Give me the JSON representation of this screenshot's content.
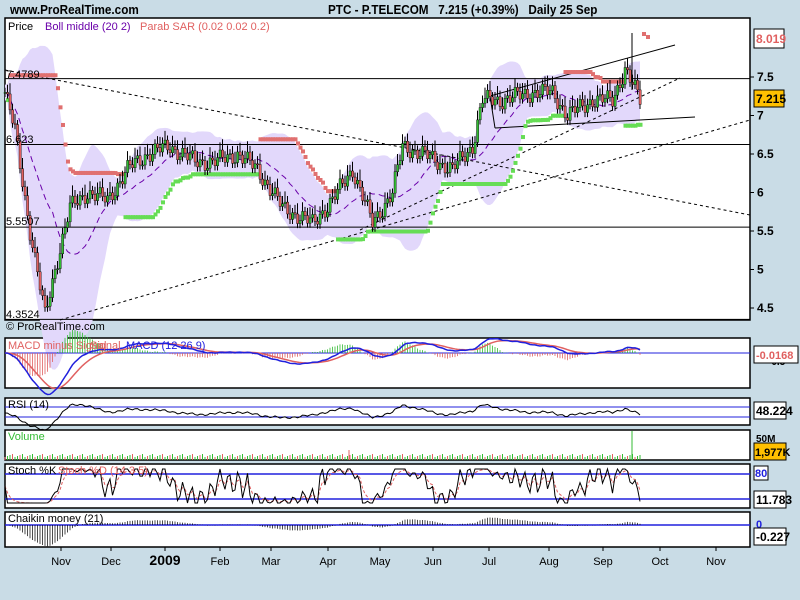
{
  "header": {
    "site": "www.ProRealTime.com",
    "title": "PTC - P.TELECOM",
    "quote": "7.215 (+0.39%)",
    "period": "Daily",
    "date": "25 Sep"
  },
  "panels": {
    "price": {
      "labels": [
        "Price",
        "Boll middle (20 2)",
        "Parab SAR (0.02 0.02 0.2)"
      ],
      "last": "7.215",
      "sar_last": "8.019",
      "watermark": "© ProRealTime.com",
      "levels": [
        "7.4789",
        "6.623",
        "5.5507",
        "4.3524"
      ]
    },
    "macd": {
      "labels": [
        "MACD minus Signal",
        "Signal",
        "MACD (12 26 9)"
      ],
      "last": "-0.0168",
      "tick": "-0.5"
    },
    "rsi": {
      "label": "RSI (14)",
      "last": "48.224"
    },
    "volume": {
      "label": "Volume",
      "tick": "50M",
      "last": "1,977K"
    },
    "stoch": {
      "labels": [
        "Stoch %K",
        "Stoch %D (14 3 5)"
      ],
      "level": "80",
      "last": "11.783"
    },
    "chaikin": {
      "label": "Chaikin money (21)",
      "zero": "0",
      "last": "-0.227"
    }
  },
  "colors": {
    "up": "#33bb33",
    "down": "#e06060",
    "sar_up": "#66dd55",
    "sar_down": "#e07070",
    "boll": "#6a00aa",
    "band": "#e2d8fb",
    "ref": "#2020dd",
    "last_bg": "#ffc000"
  },
  "chart_data": {
    "type": "candlestick",
    "x_ticks": [
      "Nov",
      "Dec",
      "2009",
      "Feb",
      "Mar",
      "Apr",
      "May",
      "Jun",
      "Jul",
      "Aug",
      "Sep",
      "Oct",
      "Nov"
    ],
    "y_ticks": [
      "7.5",
      "7",
      "6.5",
      "6",
      "5.5",
      "5",
      "4.5"
    ],
    "ylim": [
      4.3,
      7.9
    ],
    "close_keypoints": [
      [
        0,
        7.3
      ],
      [
        4,
        6.8
      ],
      [
        10,
        5.5
      ],
      [
        16,
        4.4
      ],
      [
        20,
        5.0
      ],
      [
        26,
        5.8
      ],
      [
        33,
        6.0
      ],
      [
        41,
        5.9
      ],
      [
        49,
        6.3
      ],
      [
        57,
        6.5
      ],
      [
        66,
        6.6
      ],
      [
        76,
        6.4
      ],
      [
        84,
        6.4
      ],
      [
        93,
        6.5
      ],
      [
        101,
        6.3
      ],
      [
        111,
        5.8
      ],
      [
        123,
        5.6
      ],
      [
        131,
        5.9
      ],
      [
        139,
        6.3
      ],
      [
        147,
        5.6
      ],
      [
        155,
        6.0
      ],
      [
        159,
        6.6
      ],
      [
        167,
        6.5
      ],
      [
        179,
        6.3
      ],
      [
        187,
        6.6
      ],
      [
        191,
        7.2
      ],
      [
        199,
        7.2
      ],
      [
        211,
        7.3
      ],
      [
        219,
        7.3
      ],
      [
        225,
        7.0
      ],
      [
        235,
        7.2
      ],
      [
        243,
        7.2
      ],
      [
        248,
        7.6
      ],
      [
        251,
        7.4
      ],
      [
        254,
        7.2
      ]
    ]
  }
}
